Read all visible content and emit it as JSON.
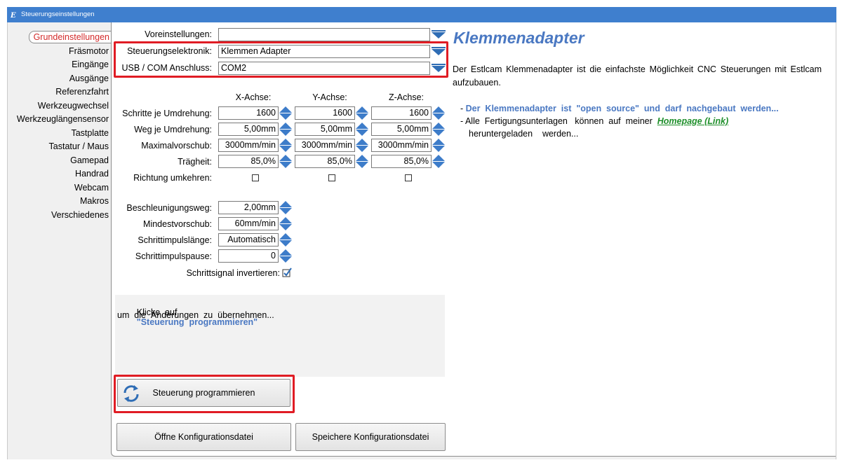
{
  "window": {
    "title": "Steuerungseinstellungen"
  },
  "nav": {
    "items": [
      {
        "label": "Grundeinstellungen",
        "active": true
      },
      {
        "label": "Fräsmotor"
      },
      {
        "label": "Eingänge"
      },
      {
        "label": "Ausgänge"
      },
      {
        "label": "Referenzfahrt"
      },
      {
        "label": "Werkzeugwechsel"
      },
      {
        "label": "Werkzeuglängensensor"
      },
      {
        "label": "Tastplatte"
      },
      {
        "label": "Tastatur / Maus"
      },
      {
        "label": "Gamepad"
      },
      {
        "label": "Handrad"
      },
      {
        "label": "Webcam"
      },
      {
        "label": "Makros"
      },
      {
        "label": "Verschiedenes"
      }
    ]
  },
  "settings": {
    "presets_label": "Voreinstellungen:",
    "presets_value": "",
    "electronics_label": "Steuerungselektronik:",
    "electronics_value": "Klemmen Adapter",
    "port_label": "USB / COM Anschluss:",
    "port_value": "COM2"
  },
  "axes": {
    "headers": [
      "X-Achse:",
      "Y-Achse:",
      "Z-Achse:"
    ],
    "rows": [
      {
        "label": "Schritte je Umdrehung:",
        "values": [
          "1600",
          "1600",
          "1600"
        ]
      },
      {
        "label": "Weg je Umdrehung:",
        "values": [
          "5,00mm",
          "5,00mm",
          "5,00mm"
        ]
      },
      {
        "label": "Maximalvorschub:",
        "values": [
          "3000mm/min",
          "3000mm/min",
          "3000mm/min"
        ]
      },
      {
        "label": "Trägheit:",
        "values": [
          "85,0%",
          "85,0%",
          "85,0%"
        ]
      }
    ],
    "reverse_label": "Richtung umkehren:"
  },
  "misc": {
    "accel_label": "Beschleunigungsweg:",
    "accel_value": "2,00mm",
    "minfeed_label": "Mindestvorschub:",
    "minfeed_value": "60mm/min",
    "pulselen_label": "Schrittimpulslänge:",
    "pulselen_value": "Automatisch",
    "pulsepause_label": "Schrittimpulspause:",
    "pulsepause_value": "0",
    "invert_label": "Schrittsignal invertieren:"
  },
  "hint": {
    "line1_prefix": "Klicke  auf",
    "line1_highlight": "\"Steuerung  programmieren\"",
    "line2": "um  die  Änderungen  zu  übernehmen..."
  },
  "buttons": {
    "program": "Steuerung programmieren",
    "open_config": "Öffne Konfigurationsdatei",
    "save_config": "Speichere Konfigurationsdatei"
  },
  "info": {
    "title": "Klemmenadapter",
    "description": "Der  Estlcam  Klemmenadapter  ist  die  einfachste  Möglichkeit  CNC  Steuerungen mit  Estlcam  aufzubauen.",
    "bullet1": "Der  Klemmenadapter  ist  \"open  source\"  und  darf  nachgebaut  werden...",
    "bullet2_prefix": "Alle  Fertigungsunterlagen   können  auf  meiner",
    "bullet2_link": "Homepage (Link)",
    "bullet2_suffix": "heruntergeladen    werden..."
  },
  "colors": {
    "title_bar": "#3f7fce",
    "accent_blue": "#4a78c2",
    "highlight_red": "#e01c24",
    "active_nav": "#d32b2b",
    "link_green": "#1e8f2a"
  }
}
